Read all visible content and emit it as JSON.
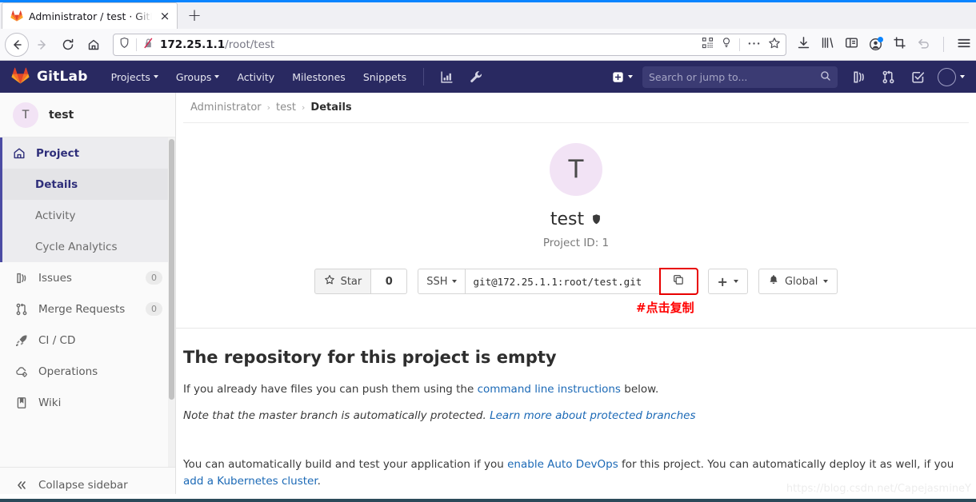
{
  "browser": {
    "tab": {
      "title": "Administrator / test · GitL",
      "favicon": "gitlab-favicon",
      "close_label": "×"
    },
    "new_tab_label": "+",
    "url": {
      "host": "172.25.1.1",
      "path": "/root/test",
      "full": "172.25.1.1/root/test"
    },
    "toolbar_icons": [
      "shield-icon",
      "broken-lock-icon",
      "qr-code-icon",
      "reader-mode-icon",
      "ellipsis-icon",
      "bookmark-star-icon",
      "download-icon",
      "library-icon",
      "sidebar-icon",
      "account-icon",
      "screenshot-icon",
      "undo-icon",
      "menu-icon"
    ]
  },
  "gitlab_header": {
    "brand": "GitLab",
    "nav": [
      {
        "label": "Projects",
        "has_caret": true
      },
      {
        "label": "Groups",
        "has_caret": true
      },
      {
        "label": "Activity",
        "has_caret": false
      },
      {
        "label": "Milestones",
        "has_caret": false
      },
      {
        "label": "Snippets",
        "has_caret": false
      }
    ],
    "icon_buttons": [
      "analytics-icon",
      "wrench-icon"
    ],
    "new_label": "+",
    "search_placeholder": "Search or jump to...",
    "right_icons": [
      "issues-icon",
      "merge-requests-icon",
      "todos-icon"
    ],
    "accent_color": "#292961"
  },
  "sidebar": {
    "project": {
      "initial": "T",
      "name": "test"
    },
    "items": [
      {
        "label": "Project",
        "icon": "home-icon",
        "type": "group-head"
      },
      {
        "label": "Details",
        "type": "sub",
        "active": true
      },
      {
        "label": "Activity",
        "type": "sub"
      },
      {
        "label": "Cycle Analytics",
        "type": "sub"
      },
      {
        "label": "Issues",
        "icon": "issues-icon",
        "badge": "0"
      },
      {
        "label": "Merge Requests",
        "icon": "merge-requests-icon",
        "badge": "0"
      },
      {
        "label": "CI / CD",
        "icon": "rocket-icon"
      },
      {
        "label": "Operations",
        "icon": "cloud-gear-icon"
      },
      {
        "label": "Wiki",
        "icon": "book-icon"
      }
    ],
    "collapse_label": "Collapse sidebar",
    "collapse_icon": "double-chevron-left-icon"
  },
  "main": {
    "breadcrumb": [
      "Administrator",
      "test",
      "Details"
    ],
    "breadcrumb_separator": "›",
    "project": {
      "initial": "T",
      "name": "test",
      "visibility_icon": "shield-private-icon",
      "project_id_label": "Project ID: 1"
    },
    "actions": {
      "star_label": "Star",
      "star_icon": "star-icon",
      "star_count": "0",
      "clone_protocol": "SSH",
      "clone_url": "git@172.25.1.1:root/test.git",
      "copy_icon": "copy-icon",
      "copy_highlight_color": "#e80000",
      "plus_label": "+",
      "notification_icon": "bell-icon",
      "notification_label": "Global"
    },
    "annotation": {
      "text": "#点击复制",
      "color": "#ff0000"
    },
    "empty_state": {
      "title": "The repository for this project is empty",
      "line1_before": "If you already have files you can push them using the ",
      "line1_link": "command line instructions",
      "line1_after": " below.",
      "line2_before": "Note that the master branch is automatically protected. ",
      "line2_link": "Learn more about protected branches",
      "line3_part1": "You can automatically build and test your application if you ",
      "line3_link1": "enable Auto DevOps",
      "line3_part2": " for this project. You can automatically deploy it as well, if you ",
      "line3_link2": "add a Kubernetes cluster",
      "line3_part3": ".",
      "link_color": "#1b69b6"
    },
    "watermark": "https://blog.csdn.net/CapejasmineY"
  }
}
